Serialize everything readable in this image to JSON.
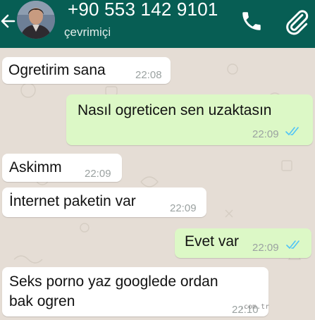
{
  "header": {
    "contact_name": "+90 553 142 9101",
    "status": "çevrimiçi",
    "back_icon": "arrow-left-icon",
    "call_icon": "phone-icon",
    "attach_icon": "paperclip-icon",
    "bar_color": "#075e54"
  },
  "messages": [
    {
      "direction": "in",
      "text": "Ogretirim sana",
      "time": "22:08"
    },
    {
      "direction": "out",
      "text": "Nasıl ogreticen sen uzaktasın",
      "time": "22:09",
      "read": true
    },
    {
      "direction": "in",
      "text": "Askimm",
      "time": "22:09"
    },
    {
      "direction": "in",
      "text": "İnternet paketin var",
      "time": "22:09"
    },
    {
      "direction": "out",
      "text": "Evet var",
      "time": "22:09",
      "read": true
    },
    {
      "direction": "in",
      "text": "Seks porno yaz googlede ordan\nbak ogren",
      "time": "22:10"
    }
  ],
  "colors": {
    "incoming_bubble": "#ffffff",
    "outgoing_bubble": "#dcf8c6",
    "read_ticks": "#4fc3f7",
    "chat_background": "#e5ddd5"
  },
  "watermark": ".com.tr"
}
